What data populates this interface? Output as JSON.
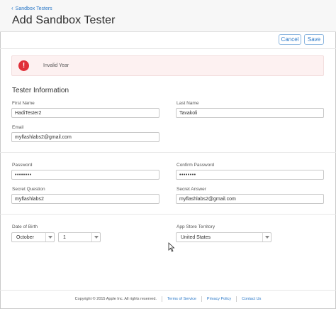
{
  "breadcrumb": {
    "back_label": "Sandbox Testers"
  },
  "header": {
    "title": "Add Sandbox Tester"
  },
  "actions": {
    "cancel_label": "Cancel",
    "save_label": "Save"
  },
  "error": {
    "message": "Invalid Year",
    "icon": "exclamation-icon"
  },
  "section": {
    "title": "Tester Information"
  },
  "fields": {
    "first_name": {
      "label": "First Name",
      "value": "HadiTester2"
    },
    "last_name": {
      "label": "Last Name",
      "value": "Tavakoli"
    },
    "email": {
      "label": "Email",
      "value": "myflashlabs2@gmail.com"
    },
    "password": {
      "label": "Password",
      "value": "••••••••"
    },
    "confirm_password": {
      "label": "Confirm Password",
      "value": "••••••••"
    },
    "secret_question": {
      "label": "Secret Question",
      "value": "myflashlabs2"
    },
    "secret_answer": {
      "label": "Secret Answer",
      "value": "myflashlabs2@gmail.com"
    },
    "date_of_birth": {
      "label": "Date of Birth",
      "month": "October",
      "day": "1"
    },
    "app_store_territory": {
      "label": "App Store Territory",
      "value": "United States"
    }
  },
  "footer": {
    "copyright": "Copyright © 2015 Apple Inc. All rights reserved.",
    "terms": "Terms of Service",
    "privacy": "Privacy Policy",
    "contact": "Contact Us"
  },
  "colors": {
    "accent": "#2a78c8",
    "error_bg": "#fdf1f1",
    "error_icon": "#e0303a"
  }
}
